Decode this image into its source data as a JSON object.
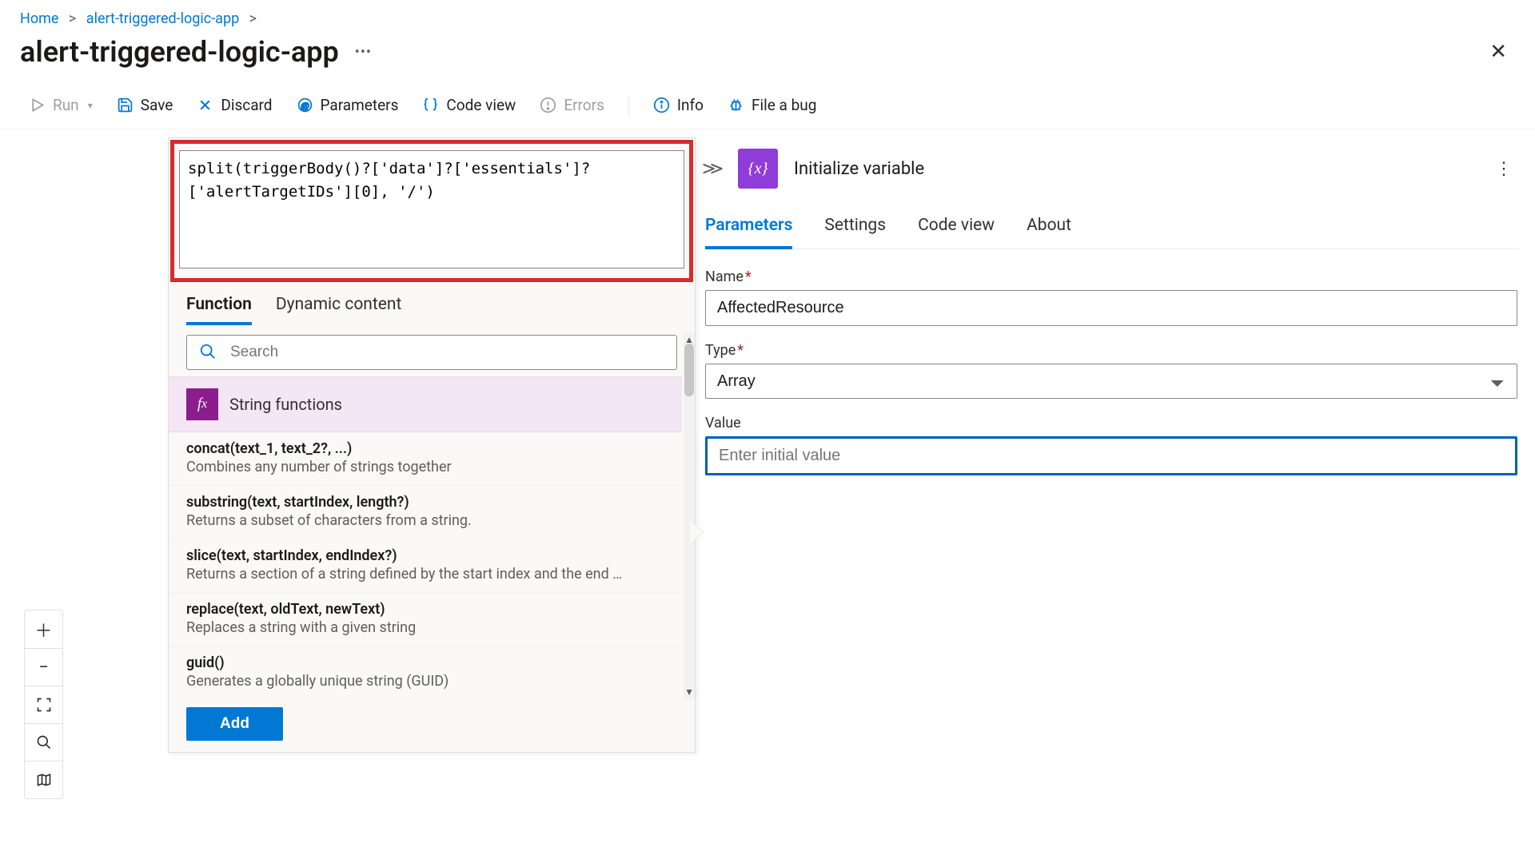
{
  "breadcrumb": {
    "home": "Home",
    "item": "alert-triggered-logic-app"
  },
  "page": {
    "title": "alert-triggered-logic-app"
  },
  "toolbar": {
    "run": "Run",
    "save": "Save",
    "discard": "Discard",
    "parameters": "Parameters",
    "code_view": "Code view",
    "errors": "Errors",
    "info": "Info",
    "file_bug": "File a bug"
  },
  "expression": {
    "value": "split(triggerBody()?['data']?['essentials']?['alertTargetIDs'][0], '/')",
    "tabs": {
      "function": "Function",
      "dynamic": "Dynamic content"
    },
    "search_placeholder": "Search",
    "category": "String functions",
    "functions": [
      {
        "sig": "concat(text_1, text_2?, ...)",
        "desc": "Combines any number of strings together"
      },
      {
        "sig": "substring(text, startIndex, length?)",
        "desc": "Returns a subset of characters from a string."
      },
      {
        "sig": "slice(text, startIndex, endIndex?)",
        "desc": "Returns a section of a string defined by the start index and the end …"
      },
      {
        "sig": "replace(text, oldText, newText)",
        "desc": "Replaces a string with a given string"
      },
      {
        "sig": "guid()",
        "desc": "Generates a globally unique string (GUID)"
      }
    ],
    "add": "Add"
  },
  "action": {
    "title": "Initialize variable",
    "tabs": {
      "parameters": "Parameters",
      "settings": "Settings",
      "code_view": "Code view",
      "about": "About"
    },
    "fields": {
      "name_label": "Name",
      "name_value": "AffectedResource",
      "type_label": "Type",
      "type_value": "Array",
      "value_label": "Value",
      "value_placeholder": "Enter initial value"
    }
  }
}
